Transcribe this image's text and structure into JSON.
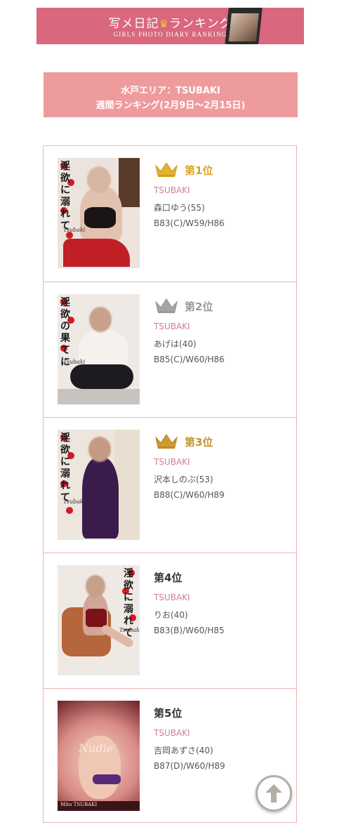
{
  "banner": {
    "title_a": "写メ日記",
    "title_b": "ランキング",
    "subtitle": "GIRLS PHOTO DIARY RANKING",
    "crown_icon": "crown-icon",
    "brand_color": "#d9677e"
  },
  "area": {
    "line1": "水戸エリア：TSUBAKI",
    "line2": "週間ランキング(2月9日〜2月15日)",
    "color": "#ee9b9d"
  },
  "ranking": [
    {
      "rank_label": "第1位",
      "crown": "gold-crown-icon",
      "shop": "TSUBAKI",
      "name": "森口ゆう(55)",
      "size": "B83(C)/W59/H86",
      "photo_text": "淫欲に溺れて",
      "photo_brand": "Tsubaki"
    },
    {
      "rank_label": "第2位",
      "crown": "silver-crown-icon",
      "shop": "TSUBAKI",
      "name": "あげは(40)",
      "size": "B85(C)/W60/H86",
      "photo_text": "淫欲の果てに",
      "photo_brand": "Tsubaki"
    },
    {
      "rank_label": "第3位",
      "crown": "bronze-crown-icon",
      "shop": "TSUBAKI",
      "name": "沢本しのぶ(53)",
      "size": "B88(C)/W60/H89",
      "photo_text": "淫欲に溺れて",
      "photo_brand": "Tsubaki"
    },
    {
      "rank_label": "第4位",
      "shop": "TSUBAKI",
      "name": "りお(40)",
      "size": "B83(B)/W60/H85",
      "photo_text": "淫欲に溺れて",
      "photo_brand": "Tsubaki"
    },
    {
      "rank_label": "第5位",
      "shop": "TSUBAKI",
      "name": "吉岡あずさ(40)",
      "size": "B87(D)/W60/H89",
      "photo_text": "Nudie",
      "photo_brand": "Mito TSUBAKI"
    }
  ],
  "colors": {
    "gold": "#d9a621",
    "silver": "#9a9a9a",
    "bronze": "#c8922b",
    "shop": "#d07f8f",
    "border": "#eab3b5"
  },
  "scroll_top_icon": "arrow-up-icon"
}
